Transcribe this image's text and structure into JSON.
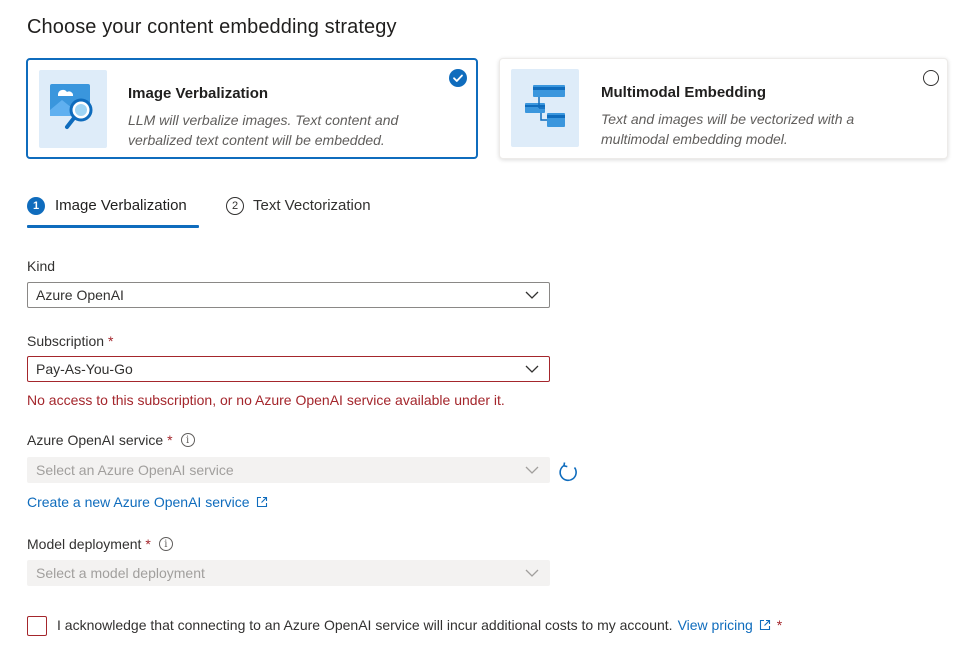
{
  "page": {
    "title": "Choose your content embedding strategy"
  },
  "strategies": [
    {
      "title": "Image Verbalization",
      "description": "LLM will verbalize images. Text content and verbalized text content will be embedded.",
      "selected": true
    },
    {
      "title": "Multimodal Embedding",
      "description": "Text and images will be vectorized with a multimodal embedding model.",
      "selected": false
    }
  ],
  "tabs": [
    {
      "number": "1",
      "label": "Image Verbalization",
      "active": true
    },
    {
      "number": "2",
      "label": "Text Vectorization",
      "active": false
    }
  ],
  "form": {
    "kind": {
      "label": "Kind",
      "value": "Azure OpenAI"
    },
    "subscription": {
      "label": "Subscription",
      "required_mark": "*",
      "value": "Pay-As-You-Go",
      "error": "No access to this subscription, or no Azure OpenAI service available under it."
    },
    "openai_service": {
      "label": "Azure OpenAI service",
      "required_mark": "*",
      "placeholder": "Select an Azure OpenAI service",
      "info_glyph": "i"
    },
    "create_link": {
      "label": "Create a new Azure OpenAI service"
    },
    "model_deployment": {
      "label": "Model deployment",
      "required_mark": "*",
      "placeholder": "Select a model deployment",
      "info_glyph": "i"
    },
    "acknowledge": {
      "text": "I acknowledge that connecting to an Azure OpenAI service will incur additional costs to my account.",
      "link": "View pricing",
      "required_mark": "*",
      "checked": false
    }
  },
  "colors": {
    "accent": "#0f6cbd",
    "error": "#a4262c",
    "tile_bg": "#deecf9"
  }
}
